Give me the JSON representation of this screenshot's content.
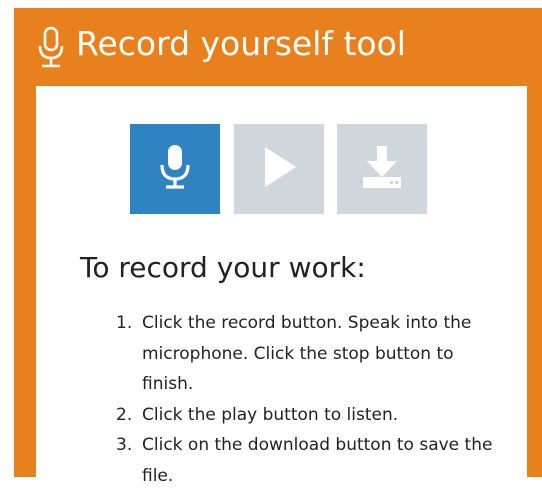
{
  "header": {
    "title": "Record yourself tool",
    "icon": "microphone-icon"
  },
  "controls": {
    "record": {
      "icon": "microphone-icon",
      "color": "#2e83c0",
      "active": true
    },
    "play": {
      "icon": "play-icon",
      "color": "#cfd7dd",
      "active": false
    },
    "download": {
      "icon": "download-icon",
      "color": "#cfd7dd",
      "active": false
    }
  },
  "instructions": {
    "heading": "To record your work:",
    "steps": [
      {
        "num": "1.",
        "text": "Click the record button. Speak into the microphone. Click the stop button to finish."
      },
      {
        "num": "2.",
        "text": "Click the play button to listen."
      },
      {
        "num": "3.",
        "text": "Click on the download button to save the file."
      }
    ]
  },
  "colors": {
    "accent": "#e8801e",
    "primary_button": "#2e83c0",
    "disabled_button": "#cfd7dd"
  }
}
